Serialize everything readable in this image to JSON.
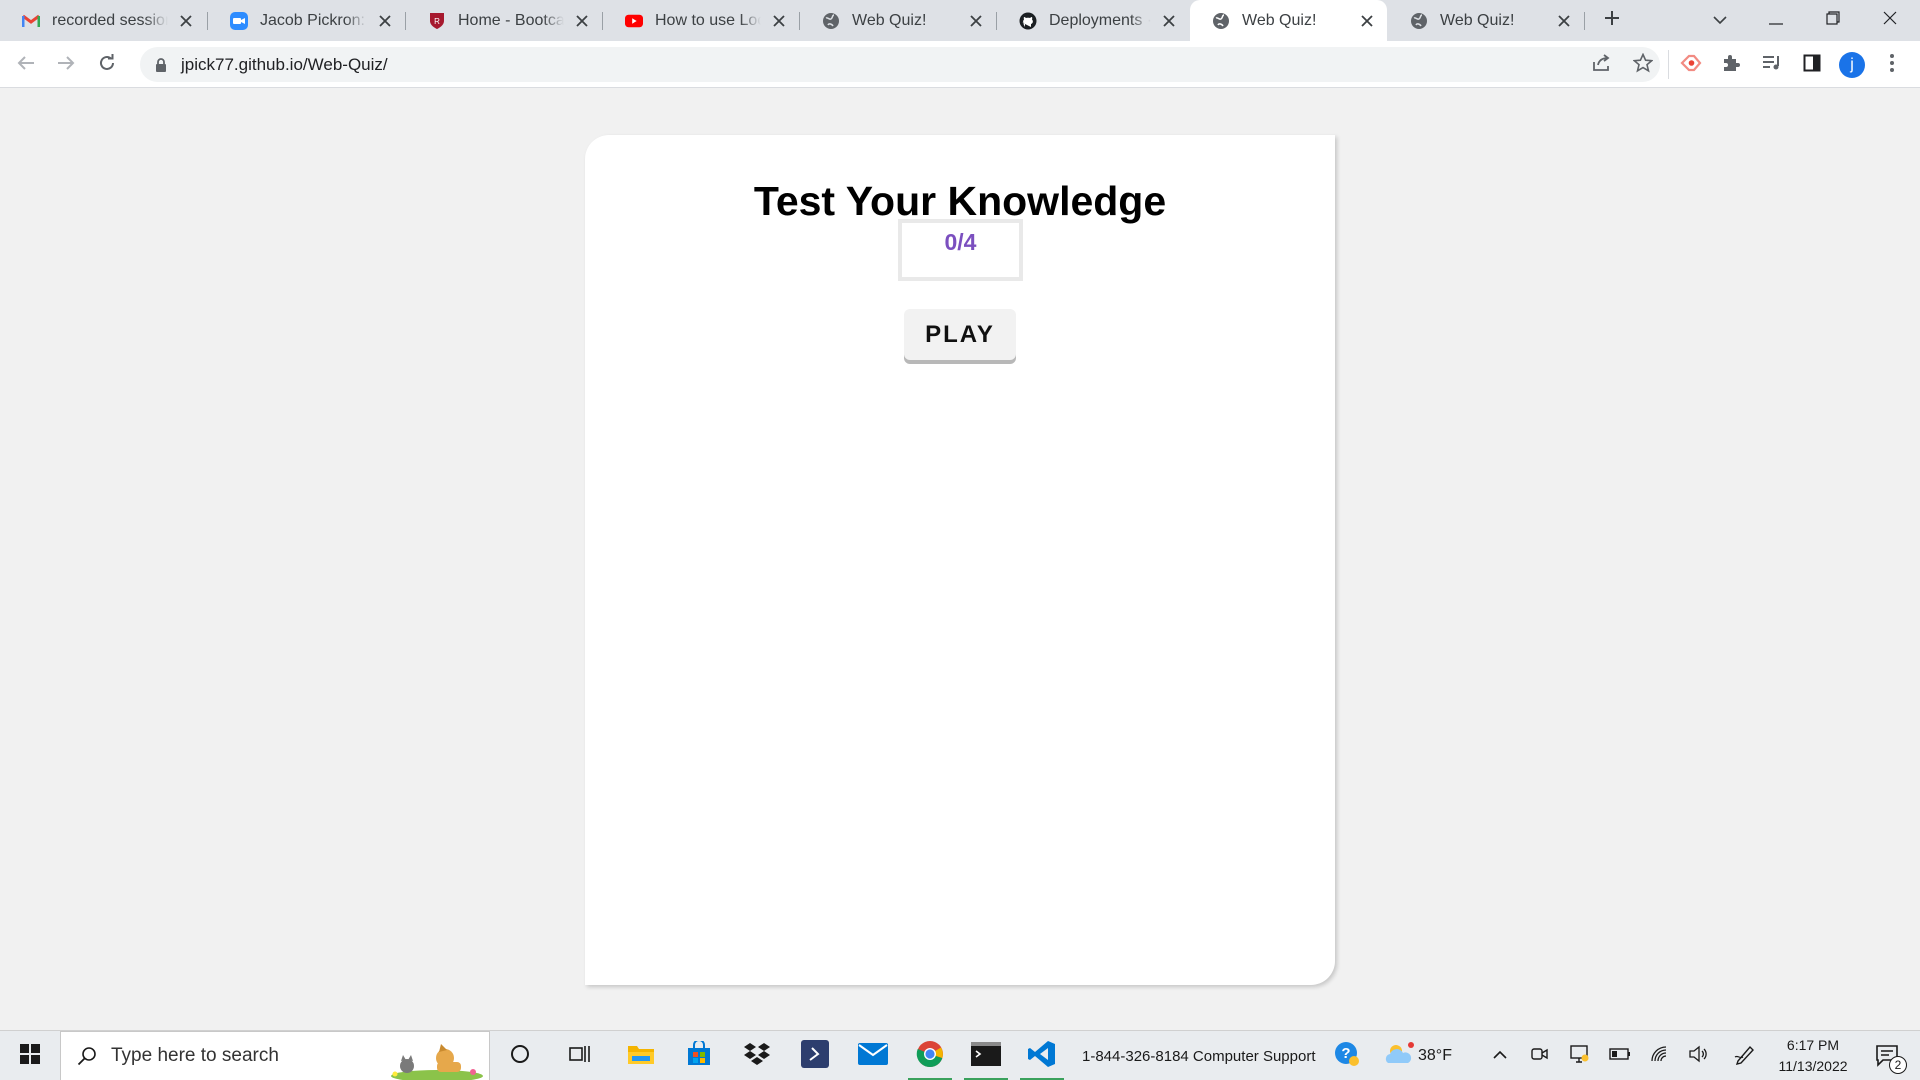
{
  "browser": {
    "tabs": [
      {
        "title": "recorded session",
        "icon": "gmail-icon",
        "active": false
      },
      {
        "title": "Jacob Pickron: Jur",
        "icon": "zoom-icon",
        "active": false
      },
      {
        "title": "Home - Bootcam",
        "icon": "bootcamp-shield-icon",
        "active": false
      },
      {
        "title": "How to use Local",
        "icon": "youtube-icon",
        "active": false
      },
      {
        "title": "Web Quiz!",
        "icon": "globe-icon",
        "active": false
      },
      {
        "title": "Deployments · jpi",
        "icon": "github-icon",
        "active": false
      },
      {
        "title": "Web Quiz!",
        "icon": "globe-icon",
        "active": true
      },
      {
        "title": "Web Quiz!",
        "icon": "globe-icon",
        "active": false
      }
    ],
    "url": "jpick77.github.io/Web-Quiz/",
    "profile_initial": "j"
  },
  "page": {
    "title": "Test Your Knowledge",
    "score": "0/4",
    "play_label": "PLAY"
  },
  "taskbar": {
    "search_placeholder": "Type here to search",
    "support_text": "1-844-326-8184 Computer Support",
    "temperature": "38°F",
    "time": "6:17 PM",
    "date": "11/13/2022",
    "notification_count": "2"
  },
  "colors": {
    "accent_purple": "#7b4fbf",
    "chrome_blue": "#1a73e8",
    "running_app_underline": "#3aa15c"
  }
}
